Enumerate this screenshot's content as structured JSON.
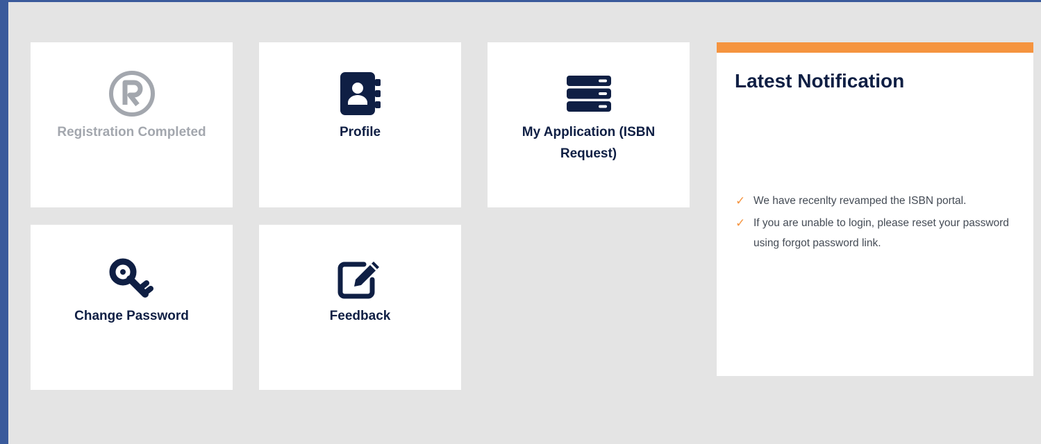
{
  "tiles": [
    {
      "label": "Registration Completed",
      "icon": "registered-icon",
      "state": "disabled"
    },
    {
      "label": "Profile",
      "icon": "contact-book-icon"
    },
    {
      "label": "My Application (ISBN Request)",
      "icon": "server-icon"
    },
    {
      "label": "Change Password",
      "icon": "key-icon"
    },
    {
      "label": "Feedback",
      "icon": "edit-icon"
    }
  ],
  "notification": {
    "title": "Latest Notification",
    "items": [
      "We have recenlty revamped the ISBN portal.",
      "If you are unable to login, please reset your password using forgot password link."
    ]
  },
  "colors": {
    "frame": "#3a5a9b",
    "background": "#e4e4e4",
    "navy": "#0f1f44",
    "accent": "#f5943f",
    "muted": "#a3a7ae"
  }
}
